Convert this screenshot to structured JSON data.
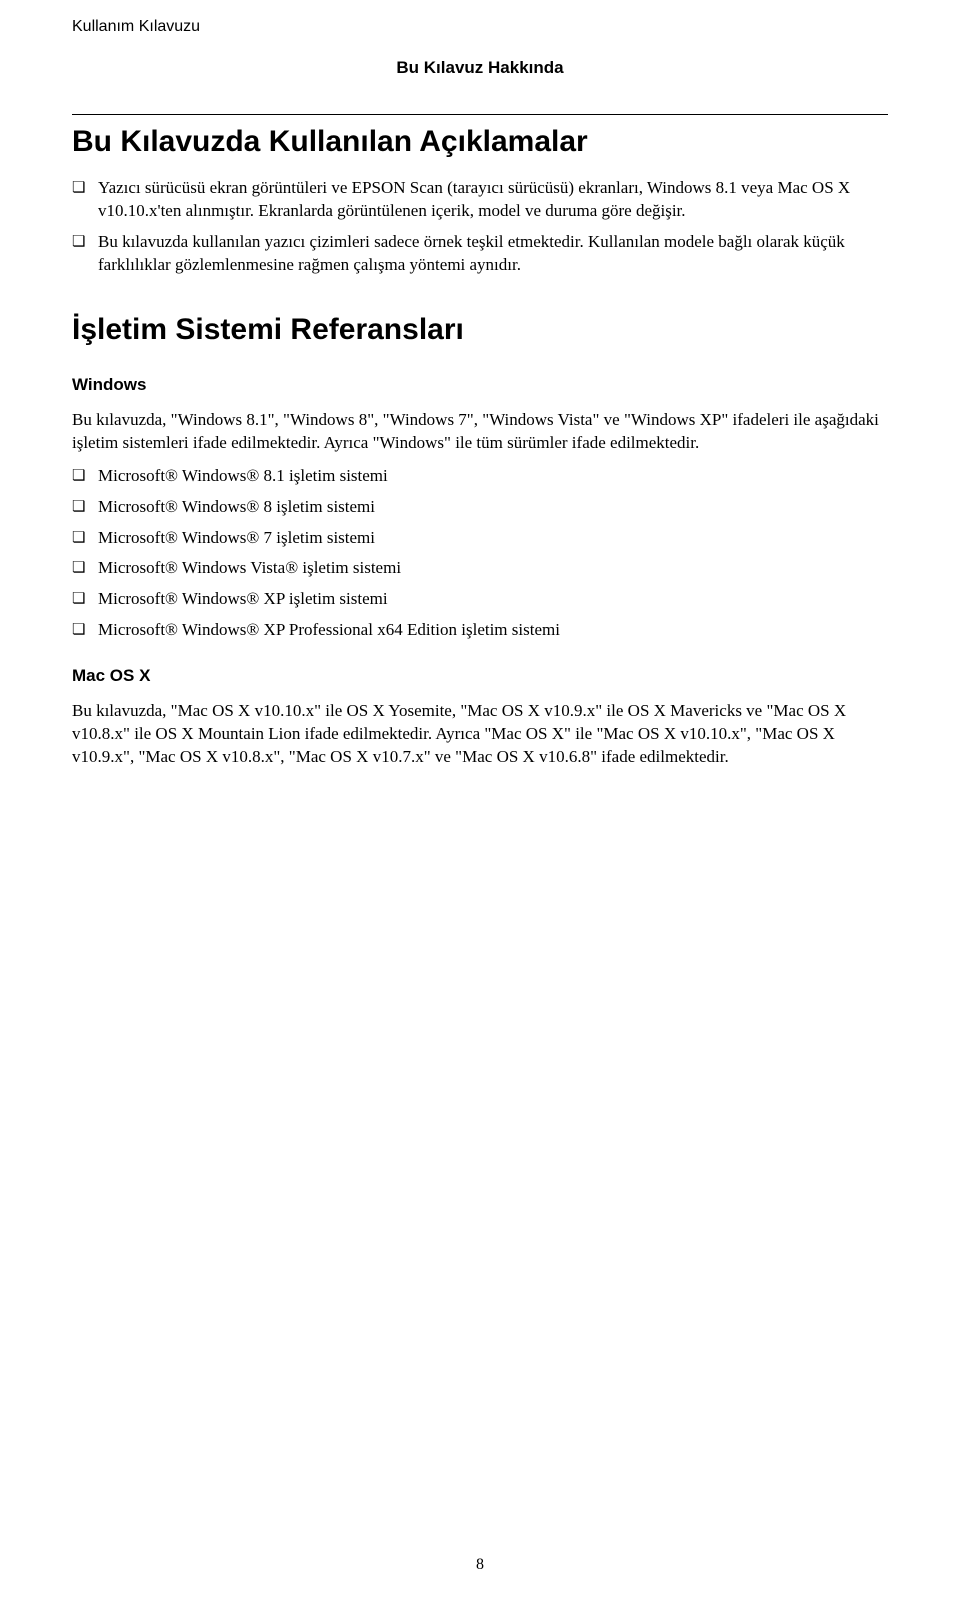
{
  "header": {
    "doc_title": "Kullanım Kılavuzu",
    "section_breadcrumb": "Bu Kılavuz Hakkında"
  },
  "section1": {
    "title": "Bu Kılavuzda Kullanılan Açıklamalar",
    "bullets": [
      "Yazıcı sürücüsü ekran görüntüleri ve EPSON Scan (tarayıcı sürücüsü) ekranları, Windows 8.1 veya Mac OS X v10.10.x'ten alınmıştır. Ekranlarda görüntülenen içerik, model ve duruma göre değişir.",
      "Bu kılavuzda kullanılan yazıcı çizimleri sadece örnek teşkil etmektedir. Kullanılan modele bağlı olarak küçük farklılıklar gözlemlenmesine rağmen çalışma yöntemi aynıdır."
    ]
  },
  "section2": {
    "title": "İşletim Sistemi Referansları",
    "windows": {
      "heading": "Windows",
      "intro": "Bu kılavuzda, \"Windows 8.1\", \"Windows 8\", \"Windows 7\", \"Windows Vista\" ve \"Windows XP\" ifadeleri ile aşağıdaki işletim sistemleri ifade edilmektedir. Ayrıca \"Windows\" ile tüm sürümler ifade edilmektedir.",
      "items": [
        "Microsoft® Windows® 8.1 işletim sistemi",
        "Microsoft® Windows® 8 işletim sistemi",
        "Microsoft® Windows® 7 işletim sistemi",
        "Microsoft® Windows Vista® işletim sistemi",
        "Microsoft® Windows® XP işletim sistemi",
        "Microsoft® Windows® XP Professional x64 Edition işletim sistemi"
      ]
    },
    "mac": {
      "heading": "Mac OS X",
      "body": "Bu kılavuzda, \"Mac OS X v10.10.x\" ile OS X Yosemite, \"Mac OS X v10.9.x\" ile OS X Mavericks ve \"Mac OS X v10.8.x\" ile OS X Mountain Lion ifade edilmektedir. Ayrıca \"Mac OS X\" ile \"Mac OS X v10.10.x\", \"Mac OS X v10.9.x\", \"Mac OS X v10.8.x\", \"Mac OS X v10.7.x\" ve \"Mac OS X v10.6.8\" ifade edilmektedir."
    }
  },
  "page_number": "8"
}
